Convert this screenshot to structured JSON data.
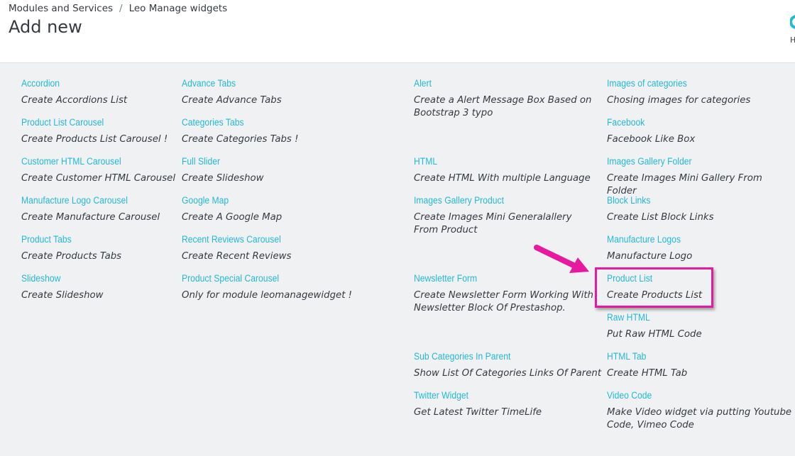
{
  "breadcrumb": {
    "parent": "Modules and Services",
    "separator": "/",
    "current": "Leo Manage widgets"
  },
  "page": {
    "title": "Add new"
  },
  "help": {
    "label": "H"
  },
  "highlight": {
    "color": "#e6199f"
  },
  "widgets": [
    {
      "title": "Accordion",
      "desc": "Create Accordions List"
    },
    {
      "title": "Product List Carousel",
      "desc": "Create Products List Carousel !"
    },
    {
      "title": "Customer HTML Carousel",
      "desc": "Create Customer HTML Carousel"
    },
    {
      "title": "Manufacture Logo Carousel",
      "desc": "Create Manufacture Carousel"
    },
    {
      "title": "Product Tabs",
      "desc": "Create Products Tabs"
    },
    {
      "title": "Slideshow",
      "desc": "Create Slideshow"
    },
    {
      "title": "Advance Tabs",
      "desc": "Create Advance Tabs"
    },
    {
      "title": "Categories Tabs",
      "desc": "Create Categories Tabs !"
    },
    {
      "title": "Full Slider",
      "desc": "Create Slideshow"
    },
    {
      "title": "Google Map",
      "desc": "Create A Google Map"
    },
    {
      "title": "Recent Reviews Carousel",
      "desc": "Create Recent Reviews"
    },
    {
      "title": "Product Special Carousel",
      "desc": "Only for module leomanagewidget !"
    },
    {
      "title": "Alert",
      "desc": "Create a Alert Message Box Based on Bootstrap 3 typo"
    },
    {
      "title": "HTML",
      "desc": "Create HTML With multiple Language"
    },
    {
      "title": "Images Gallery Product",
      "desc": "Create Images Mini Generalallery From Product"
    },
    {
      "title": "Newsletter Form",
      "desc": "Create Newsletter Form Working With Newsletter Block Of Prestashop."
    },
    {
      "title": "Sub Categories In Parent",
      "desc": "Show List Of Categories Links Of Parent"
    },
    {
      "title": "Twitter Widget",
      "desc": "Get Latest Twitter TimeLife"
    },
    {
      "title": "Images of categories",
      "desc": "Chosing images for categories"
    },
    {
      "title": "Facebook",
      "desc": "Facebook Like Box"
    },
    {
      "title": "Images Gallery Folder",
      "desc": "Create Images Mini Gallery From Folder"
    },
    {
      "title": "Block Links",
      "desc": "Create List Block Links"
    },
    {
      "title": "Manufacture Logos",
      "desc": "Manufacture Logo"
    },
    {
      "title": "Product List",
      "desc": "Create Products List"
    },
    {
      "title": "Raw HTML",
      "desc": "Put Raw HTML Code"
    },
    {
      "title": "HTML Tab",
      "desc": "Create HTML Tab"
    },
    {
      "title": "Video Code",
      "desc": "Make Video widget via putting Youtube Code, Vimeo Code"
    }
  ]
}
